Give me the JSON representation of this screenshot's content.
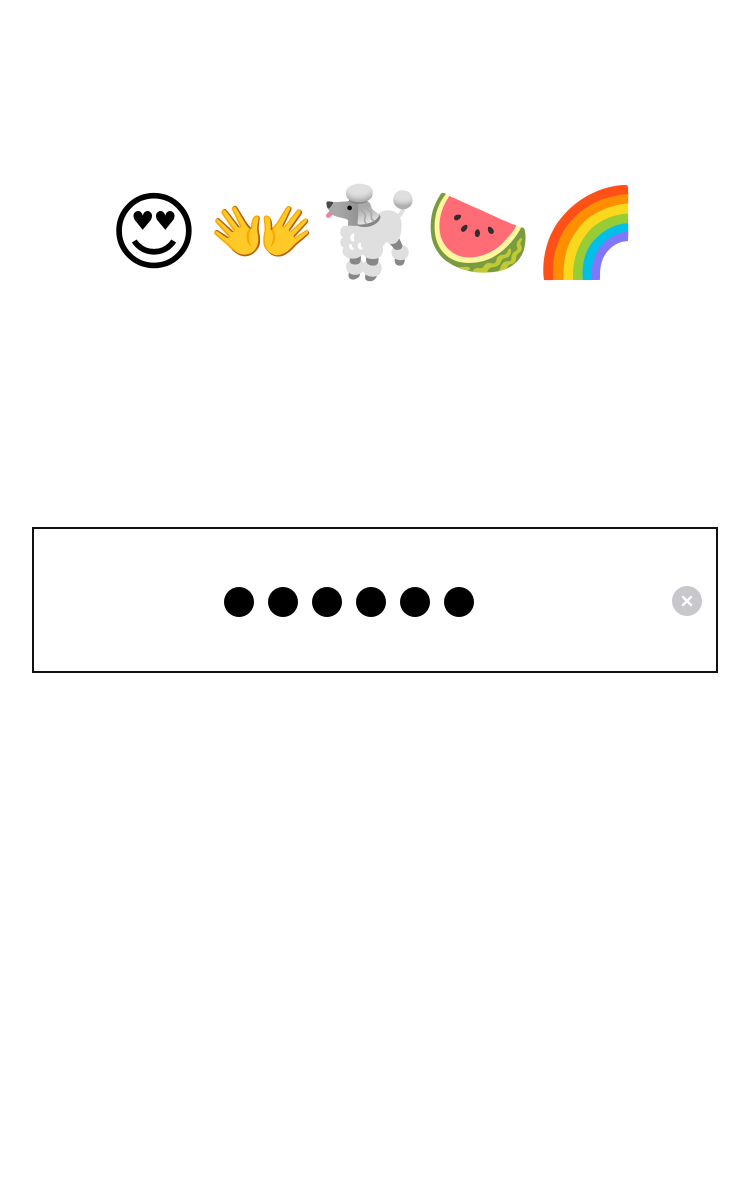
{
  "emoji_sequence": [
    {
      "name": "smiling-face-with-heart-eyes",
      "char": "😍"
    },
    {
      "name": "open-hands",
      "char": "👐"
    },
    {
      "name": "poodle",
      "char": "🐩"
    },
    {
      "name": "watermelon",
      "char": "🍉"
    },
    {
      "name": "rainbow",
      "char": "🌈"
    }
  ],
  "passcode": {
    "entered_digits_count": 6
  },
  "clear_button": {
    "icon": "clear-icon"
  }
}
